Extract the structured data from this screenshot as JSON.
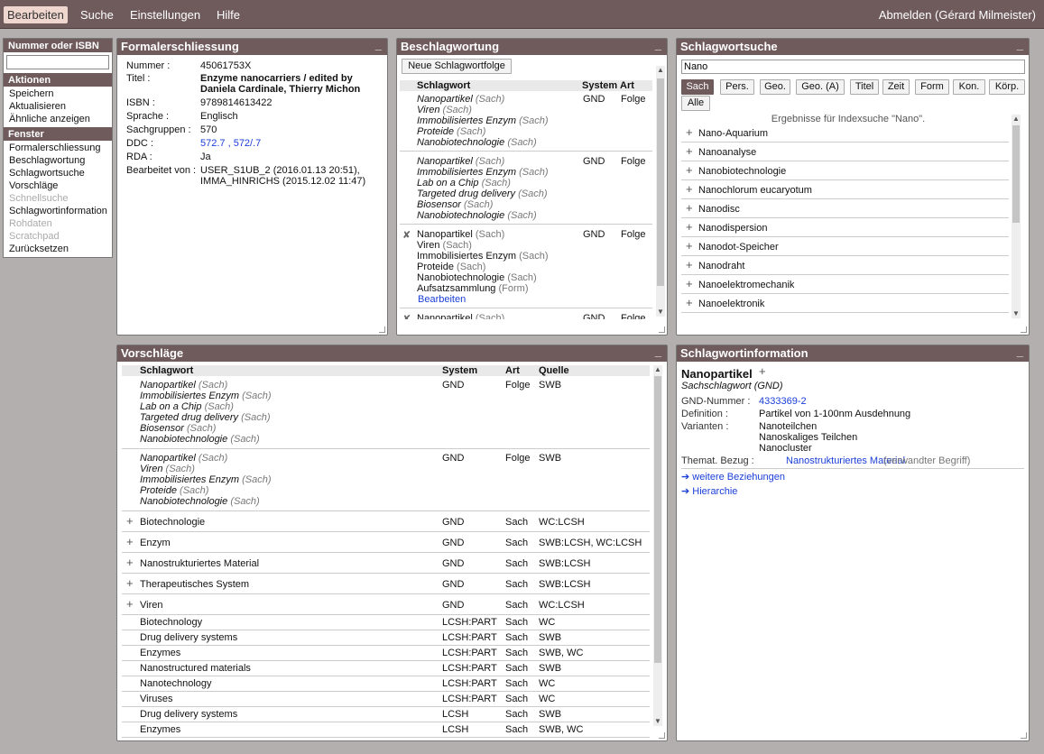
{
  "topbar": {
    "menu": [
      "Bearbeiten",
      "Suche",
      "Einstellungen",
      "Hilfe"
    ],
    "logout": "Abmelden (Gérard Milmeister)"
  },
  "sidebar": {
    "search_title": "Nummer oder ISBN",
    "search_value": "",
    "actions_title": "Aktionen",
    "actions": [
      "Speichern",
      "Aktualisieren",
      "Ähnliche anzeigen"
    ],
    "windows_title": "Fenster",
    "windows": [
      {
        "label": "Formalerschliessung",
        "enabled": true
      },
      {
        "label": "Beschlagwortung",
        "enabled": true
      },
      {
        "label": "Schlagwortsuche",
        "enabled": true
      },
      {
        "label": "Vorschläge",
        "enabled": true
      },
      {
        "label": "Schnellsuche",
        "enabled": false
      },
      {
        "label": "Schlagwortinformation",
        "enabled": true
      },
      {
        "label": "Rohdaten",
        "enabled": false
      },
      {
        "label": "Scratchpad",
        "enabled": false
      },
      {
        "label": "Zurücksetzen",
        "enabled": true
      }
    ]
  },
  "formal": {
    "title": "Formalerschliessung",
    "minimize": "_",
    "fields": [
      {
        "label": "Nummer :",
        "value": "45061753X"
      },
      {
        "label": "Titel :",
        "value": "Enzyme nanocarriers / edited by",
        "value2": "Daniela Cardinale, Thierry Michon"
      },
      {
        "label": "ISBN :",
        "value": "9789814613422"
      },
      {
        "label": "Sprache :",
        "value": "Englisch"
      },
      {
        "label": "Sachgruppen :",
        "value": "570"
      },
      {
        "label": "DDC :",
        "value": "572.7 ,  572/.7"
      },
      {
        "label": "RDA :",
        "value": "Ja"
      },
      {
        "label": "Bearbeitet von :",
        "value": "USER_S1UB_2 (2016.01.13 20:51),",
        "value2": "IMMA_HINRICHS (2015.12.02 11:47)"
      }
    ]
  },
  "besch": {
    "title": "Beschlagwortung",
    "minimize": "_",
    "new_button": "Neue Schlagwortfolge",
    "headers": [
      "Schlagwort",
      "System",
      "Art"
    ],
    "groups": [
      {
        "terms": [
          [
            "Nanopartikel",
            "(Sach)"
          ],
          [
            "Viren",
            "(Sach)"
          ],
          [
            "Immobilisiertes Enzym",
            "(Sach)"
          ],
          [
            "Proteide",
            "(Sach)"
          ],
          [
            "Nanobiotechnologie",
            "(Sach)"
          ]
        ],
        "system": "GND",
        "art": "Folge",
        "italic": true
      },
      {
        "terms": [
          [
            "Nanopartikel",
            "(Sach)"
          ],
          [
            "Immobilisiertes Enzym",
            "(Sach)"
          ],
          [
            "Lab on a Chip",
            "(Sach)"
          ],
          [
            "Targeted drug delivery",
            "(Sach)"
          ],
          [
            "Biosensor",
            "(Sach)"
          ],
          [
            "Nanobiotechnologie",
            "(Sach)"
          ]
        ],
        "system": "GND",
        "art": "Folge",
        "italic": true
      },
      {
        "terms": [
          [
            "Nanopartikel",
            "(Sach)"
          ],
          [
            "Viren",
            "(Sach)"
          ],
          [
            "Immobilisiertes Enzym",
            "(Sach)"
          ],
          [
            "Proteide",
            "(Sach)"
          ],
          [
            "Nanobiotechnologie",
            "(Sach)"
          ],
          [
            "Aufsatzsammlung",
            "(Form)"
          ]
        ],
        "system": "GND",
        "art": "Folge",
        "italic": false,
        "edit": "Bearbeiten",
        "delete": "✘"
      },
      {
        "terms": [
          [
            "Nanopartikel",
            "(Sach)"
          ]
        ],
        "system": "GND",
        "art": "Folge",
        "italic": false,
        "delete": "✘"
      }
    ]
  },
  "search": {
    "title": "Schlagwortsuche",
    "minimize": "_",
    "query": "Nano",
    "buttons": [
      "Sach",
      "Pers.",
      "Geo.",
      "Geo. (A)",
      "Titel",
      "Zeit",
      "Form",
      "Kon.",
      "Körp.",
      "Alle"
    ],
    "result_caption": "Ergebnisse für Indexsuche \"Nano\".",
    "results": [
      "Nano-Aquarium",
      "Nanoanalyse",
      "Nanobiotechnologie",
      "Nanochlorum eucaryotum",
      "Nanodisc",
      "Nanodispersion",
      "Nanodot-Speicher",
      "Nanodraht",
      "Nanoelektromechanik",
      "Nanoelektronik"
    ]
  },
  "vor": {
    "title": "Vorschläge",
    "minimize": "_",
    "headers": [
      "Schlagwort",
      "System",
      "Art",
      "Quelle"
    ],
    "groups": [
      {
        "terms": [
          [
            "Nanopartikel",
            "(Sach)"
          ],
          [
            "Immobilisiertes Enzym",
            "(Sach)"
          ],
          [
            "Lab on a Chip",
            "(Sach)"
          ],
          [
            "Targeted drug delivery",
            "(Sach)"
          ],
          [
            "Biosensor",
            "(Sach)"
          ],
          [
            "Nanobiotechnologie",
            "(Sach)"
          ]
        ],
        "system": "GND",
        "art": "Folge",
        "quelle": "SWB"
      },
      {
        "terms": [
          [
            "Nanopartikel",
            "(Sach)"
          ],
          [
            "Viren",
            "(Sach)"
          ],
          [
            "Immobilisiertes Enzym",
            "(Sach)"
          ],
          [
            "Proteide",
            "(Sach)"
          ],
          [
            "Nanobiotechnologie",
            "(Sach)"
          ]
        ],
        "system": "GND",
        "art": "Folge",
        "quelle": "SWB"
      }
    ],
    "plus_rows": [
      {
        "term": "Biotechnologie",
        "system": "GND",
        "art": "Sach",
        "quelle": "WC:LCSH"
      },
      {
        "term": "Enzym",
        "system": "GND",
        "art": "Sach",
        "quelle": "SWB:LCSH, WC:LCSH"
      },
      {
        "term": "Nanostrukturiertes Material",
        "system": "GND",
        "art": "Sach",
        "quelle": "SWB:LCSH"
      },
      {
        "term": "Therapeutisches System",
        "system": "GND",
        "art": "Sach",
        "quelle": "SWB:LCSH"
      },
      {
        "term": "Viren",
        "system": "GND",
        "art": "Sach",
        "quelle": "WC:LCSH"
      }
    ],
    "rows": [
      {
        "term": "Biotechnology",
        "system": "LCSH:PART",
        "art": "Sach",
        "quelle": "WC"
      },
      {
        "term": "Drug delivery systems",
        "system": "LCSH:PART",
        "art": "Sach",
        "quelle": "SWB"
      },
      {
        "term": "Enzymes",
        "system": "LCSH:PART",
        "art": "Sach",
        "quelle": "SWB, WC"
      },
      {
        "term": "Nanostructured materials",
        "system": "LCSH:PART",
        "art": "Sach",
        "quelle": "SWB"
      },
      {
        "term": "Nanotechnology",
        "system": "LCSH:PART",
        "art": "Sach",
        "quelle": "WC"
      },
      {
        "term": "Viruses",
        "system": "LCSH:PART",
        "art": "Sach",
        "quelle": "WC"
      },
      {
        "term": "Drug delivery systems",
        "system": "LCSH",
        "art": "Sach",
        "quelle": "SWB"
      },
      {
        "term": "Enzymes",
        "system": "LCSH",
        "art": "Sach",
        "quelle": "SWB, WC"
      }
    ]
  },
  "info": {
    "title": "Schlagwortinformation",
    "minimize": "_",
    "term": "Nanopartikel",
    "type": "Sachschlagwort (GND)",
    "gnd_label": "GND-Nummer :",
    "gnd_value": "4333369-2",
    "def_label": "Definition :",
    "def_value": "Partikel von 1-100nm Ausdehnung",
    "var_label": "Varianten :",
    "variants": [
      "Nanoteilchen",
      "Nanoskaliges Teilchen",
      "Nanocluster"
    ],
    "rel_label": "Themat. Bezug :",
    "rel_value": "Nanostrukturiertes Material",
    "rel_note": "(verwandter Begriff)",
    "link1": "➔ weitere Beziehungen",
    "link2": "➔ Hierarchie"
  }
}
